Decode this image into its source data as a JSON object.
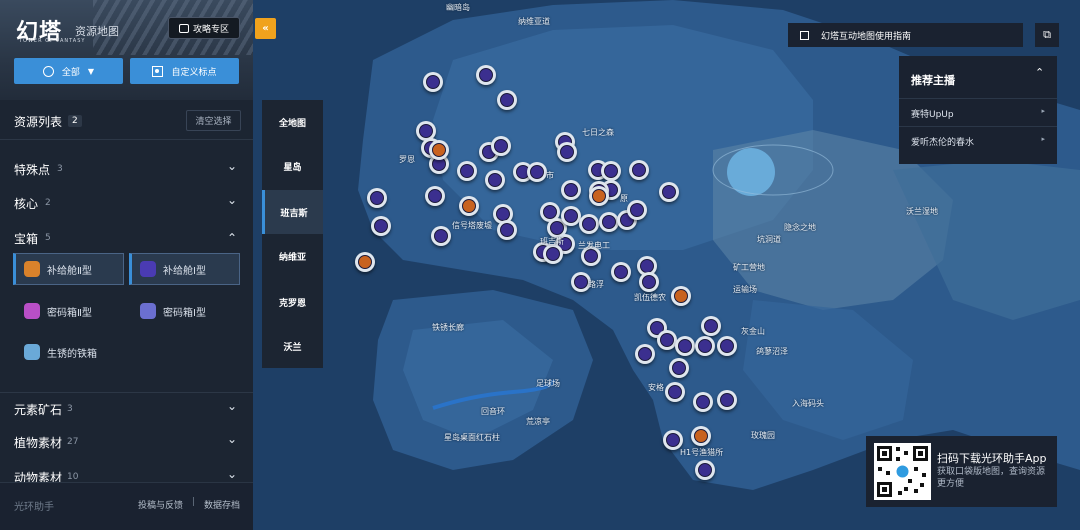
{
  "header": {
    "logo": "幻塔",
    "logo_sub": "TOWER OF FANTASY",
    "title": "资源地图",
    "guide_label": "攻略专区",
    "all_label": "全部",
    "custom_label": "自定义标点"
  },
  "resource_list": {
    "title": "资源列表",
    "count": "2",
    "clear_label": "清空选择",
    "categories": [
      {
        "name": "特殊点",
        "count": "3"
      },
      {
        "name": "核心",
        "count": "2"
      },
      {
        "name": "宝箱",
        "count": "5"
      },
      {
        "name": "元素矿石",
        "count": "3"
      },
      {
        "name": "植物素材",
        "count": "27"
      },
      {
        "name": "动物素材",
        "count": "10"
      }
    ],
    "chest_items": [
      {
        "label": "补给舱Ⅱ型",
        "color": "#d9822b"
      },
      {
        "label": "补给舱Ⅰ型",
        "color": "#4a3bb3"
      },
      {
        "label": "密码箱Ⅱ型",
        "color": "#b94fc7"
      },
      {
        "label": "密码箱Ⅰ型",
        "color": "#6b6fd0"
      },
      {
        "label": "生锈的铁箱",
        "color": "#6aa9d8"
      }
    ]
  },
  "footer": {
    "brand": "光环助手",
    "links": [
      "投稿与反馈",
      "数据存档"
    ],
    "separator": "|"
  },
  "regions": [
    "全地图",
    "星岛",
    "班吉斯",
    "纳维亚",
    "克罗恩",
    "沃兰"
  ],
  "active_region": "班吉斯",
  "map": {
    "guide_text": "幻塔互动地图使用指南",
    "places": [
      "幽暗岛",
      "纳维亚道",
      "七日之森",
      "罗恩",
      "信号塔废墟",
      "市",
      "原",
      "班吉斯",
      "兰发电工",
      "路浮",
      "凯伍德农",
      "隐念之地",
      "坑洞道",
      "矿工营地",
      "运输场",
      "沃兰湿地",
      "铁锈长廊",
      "足球场",
      "回音环",
      "荒凉亭",
      "星岛桌面红石柱",
      "灰金山",
      "鸽蓼沼泽",
      "安格",
      "入海码头",
      "玫瑰园",
      "H1号渔猎所"
    ]
  },
  "streamers": {
    "title": "推荐主播",
    "items": [
      "赛特UpUp",
      "爱听杰伦的春水"
    ]
  },
  "qr": {
    "title": "扫码下载光环助手App",
    "desc": "获取口袋版地图，查询资源更方便"
  },
  "colors": {
    "accent": "#3a8fd8",
    "collapse": "#f0a21d",
    "sidebar_bg": "#1c2532",
    "map_water": "#1e3f66"
  }
}
